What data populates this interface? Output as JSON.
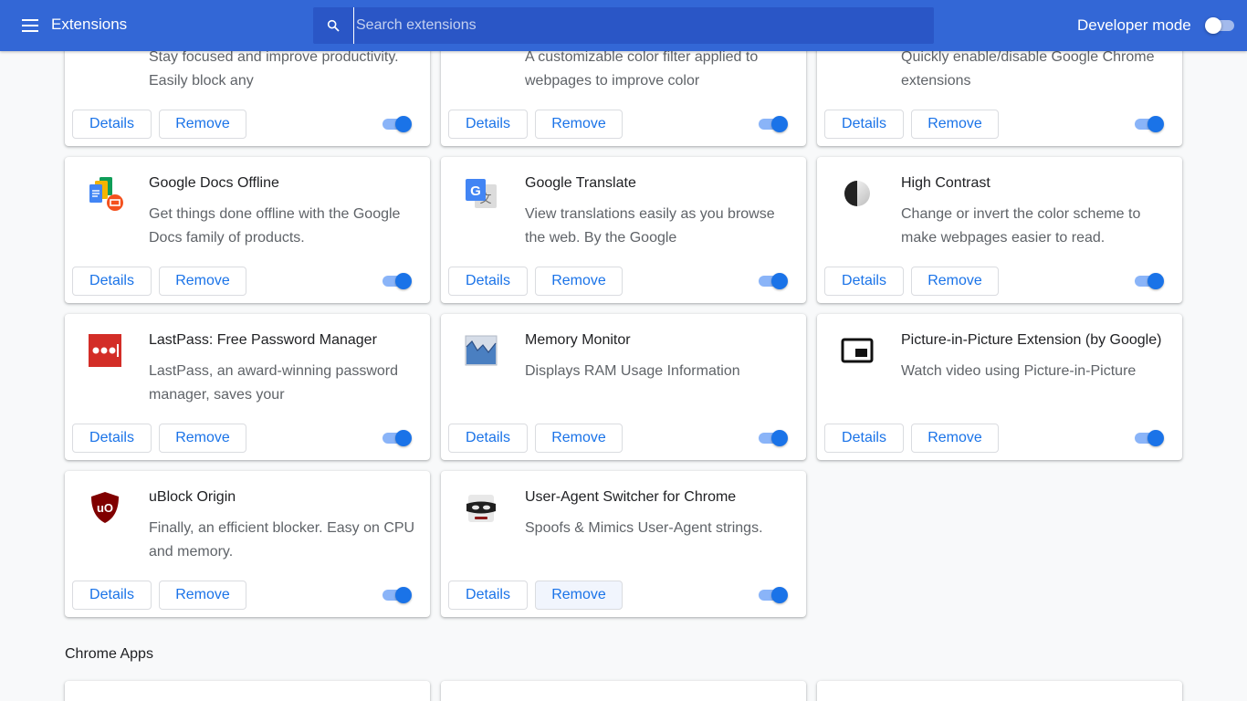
{
  "header": {
    "title": "Extensions",
    "search_placeholder": "Search extensions",
    "search_value": "",
    "developer_mode_label": "Developer mode",
    "developer_mode_on": false
  },
  "colors": {
    "toolbar": "#3367d6",
    "accent": "#1a73e8",
    "toggle_track": "#8ab4f8"
  },
  "cards": [
    {
      "name": "",
      "description": "Stay focused and improve productivity. Easily block any",
      "details": "Details",
      "remove": "Remove",
      "enabled": true,
      "icon": "partial-icon"
    },
    {
      "name": "",
      "description": "A customizable color filter applied to webpages to improve color",
      "details": "Details",
      "remove": "Remove",
      "enabled": true,
      "icon": "partial-icon"
    },
    {
      "name": "",
      "description": "Quickly enable/disable Google Chrome extensions",
      "details": "Details",
      "remove": "Remove",
      "enabled": true,
      "icon": "partial-icon"
    },
    {
      "name": "Google Docs Offline",
      "description": "Get things done offline with the Google Docs family of products.",
      "details": "Details",
      "remove": "Remove",
      "enabled": true,
      "icon": "google-docs-offline-icon"
    },
    {
      "name": "Google Translate",
      "description": "View translations easily as you browse the web. By the Google",
      "details": "Details",
      "remove": "Remove",
      "enabled": true,
      "icon": "google-translate-icon"
    },
    {
      "name": "High Contrast",
      "description": "Change or invert the color scheme to make webpages easier to read.",
      "details": "Details",
      "remove": "Remove",
      "enabled": true,
      "icon": "high-contrast-icon"
    },
    {
      "name": "LastPass: Free Password Manager",
      "description": "LastPass, an award-winning password manager, saves your",
      "details": "Details",
      "remove": "Remove",
      "enabled": true,
      "icon": "lastpass-icon"
    },
    {
      "name": "Memory Monitor",
      "description": "Displays RAM Usage Information",
      "details": "Details",
      "remove": "Remove",
      "enabled": true,
      "icon": "memory-monitor-icon"
    },
    {
      "name": "Picture-in-Picture Extension (by Google)",
      "description": "Watch video using Picture-in-Picture",
      "details": "Details",
      "remove": "Remove",
      "enabled": true,
      "icon": "picture-in-picture-icon"
    },
    {
      "name": "uBlock Origin",
      "description": "Finally, an efficient blocker. Easy on CPU and memory.",
      "details": "Details",
      "remove": "Remove",
      "enabled": true,
      "icon": "ublock-origin-icon"
    },
    {
      "name": "User-Agent Switcher for Chrome",
      "description": "Spoofs & Mimics User-Agent strings.",
      "details": "Details",
      "remove": "Remove",
      "enabled": true,
      "icon": "user-agent-switcher-icon"
    }
  ],
  "chrome_apps": {
    "title": "Chrome Apps"
  }
}
